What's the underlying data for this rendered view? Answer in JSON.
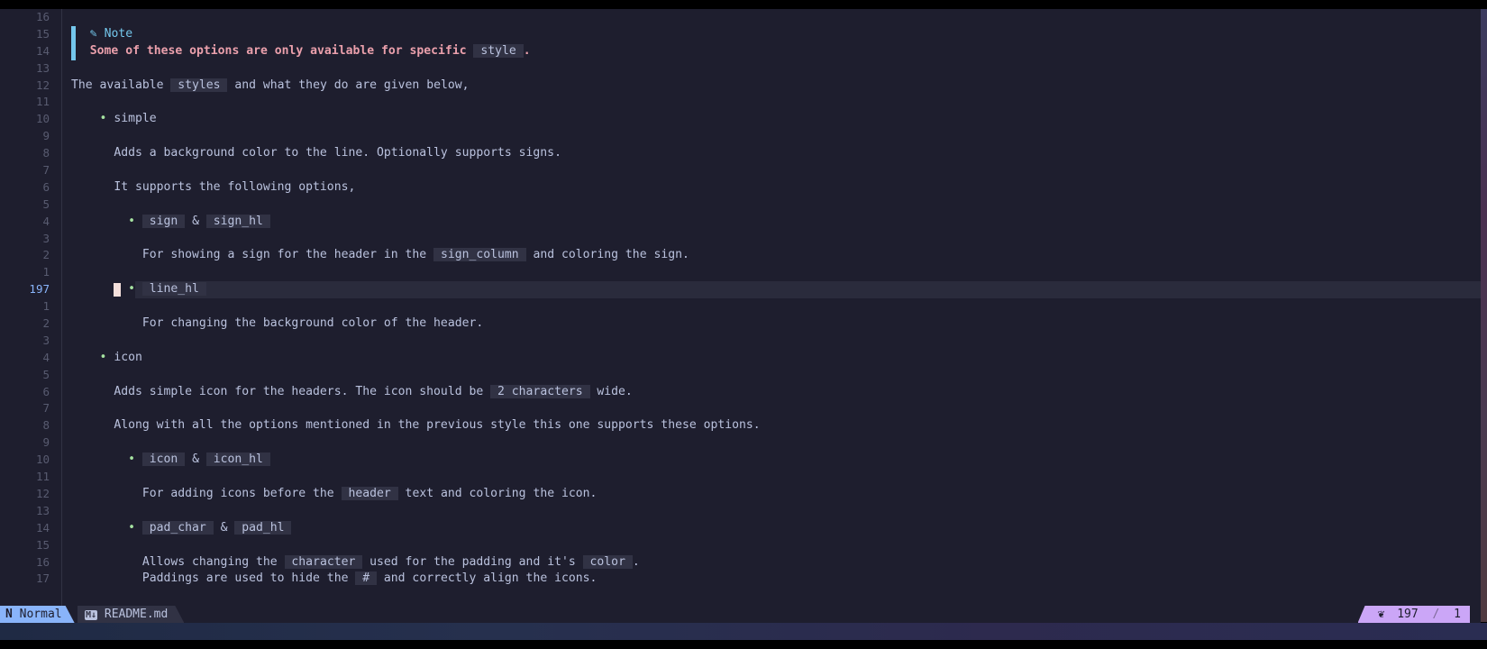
{
  "colors": {
    "background": "#1e1e2e",
    "code_bg": "#313244",
    "note": "#74c7ec",
    "note_text": "#eba0ac",
    "bullet": "#a6e3a1",
    "mode": "#89b4fa",
    "position": "#cba6f7",
    "cursor": "#f5e0dc"
  },
  "lines": [
    {
      "num": "16",
      "kind": "empty"
    },
    {
      "num": "15",
      "kind": "note-title",
      "icon": "pencil-icon",
      "segments": [
        {
          "t": "Note"
        }
      ]
    },
    {
      "num": "14",
      "kind": "note-text",
      "segments": [
        {
          "t": "Some of these options are only available for specific "
        },
        {
          "t": "style",
          "code": true
        },
        {
          "t": "."
        }
      ]
    },
    {
      "num": "13",
      "kind": "empty"
    },
    {
      "num": "12",
      "kind": "para",
      "level": 0,
      "segments": [
        {
          "t": "The available "
        },
        {
          "t": "styles",
          "code": true
        },
        {
          "t": " and what they do are given below,"
        }
      ]
    },
    {
      "num": "11",
      "kind": "empty"
    },
    {
      "num": "10",
      "kind": "bullet",
      "level": 1,
      "segments": [
        {
          "t": "simple"
        }
      ]
    },
    {
      "num": "9",
      "kind": "empty"
    },
    {
      "num": "8",
      "kind": "para",
      "level": 1,
      "segments": [
        {
          "t": "Adds a background color to the line. Optionally supports signs."
        }
      ]
    },
    {
      "num": "7",
      "kind": "empty"
    },
    {
      "num": "6",
      "kind": "para",
      "level": 1,
      "segments": [
        {
          "t": "It supports the following options,"
        }
      ]
    },
    {
      "num": "5",
      "kind": "empty"
    },
    {
      "num": "4",
      "kind": "bullet",
      "level": 2,
      "segments": [
        {
          "t": "sign",
          "code": true
        },
        {
          "t": " & "
        },
        {
          "t": "sign_hl",
          "code": true
        }
      ]
    },
    {
      "num": "3",
      "kind": "empty"
    },
    {
      "num": "2",
      "kind": "para",
      "level": 2,
      "segments": [
        {
          "t": "For showing a sign for the header in the "
        },
        {
          "t": "sign_column",
          "code": true
        },
        {
          "t": " and coloring the sign."
        }
      ]
    },
    {
      "num": "1",
      "kind": "empty"
    },
    {
      "num": "197",
      "kind": "bullet",
      "level": 2,
      "current": true,
      "segments": [
        {
          "t": "line_hl",
          "code": true
        }
      ]
    },
    {
      "num": "1",
      "kind": "empty"
    },
    {
      "num": "2",
      "kind": "para",
      "level": 2,
      "segments": [
        {
          "t": "For changing the background color of the header."
        }
      ]
    },
    {
      "num": "3",
      "kind": "empty"
    },
    {
      "num": "4",
      "kind": "bullet",
      "level": 1,
      "segments": [
        {
          "t": "icon"
        }
      ]
    },
    {
      "num": "5",
      "kind": "empty"
    },
    {
      "num": "6",
      "kind": "para",
      "level": 1,
      "segments": [
        {
          "t": "Adds simple icon for the headers. The icon should be "
        },
        {
          "t": "2 characters",
          "code": true
        },
        {
          "t": " wide."
        }
      ]
    },
    {
      "num": "7",
      "kind": "empty"
    },
    {
      "num": "8",
      "kind": "para",
      "level": 1,
      "segments": [
        {
          "t": "Along with all the options mentioned in the previous style this one supports these options."
        }
      ]
    },
    {
      "num": "9",
      "kind": "empty"
    },
    {
      "num": "10",
      "kind": "bullet",
      "level": 2,
      "segments": [
        {
          "t": "icon",
          "code": true
        },
        {
          "t": " & "
        },
        {
          "t": "icon_hl",
          "code": true
        }
      ]
    },
    {
      "num": "11",
      "kind": "empty"
    },
    {
      "num": "12",
      "kind": "para",
      "level": 2,
      "segments": [
        {
          "t": "For adding icons before the "
        },
        {
          "t": "header",
          "code": true
        },
        {
          "t": " text and coloring the icon."
        }
      ]
    },
    {
      "num": "13",
      "kind": "empty"
    },
    {
      "num": "14",
      "kind": "bullet",
      "level": 2,
      "segments": [
        {
          "t": "pad_char",
          "code": true
        },
        {
          "t": " & "
        },
        {
          "t": "pad_hl",
          "code": true
        }
      ]
    },
    {
      "num": "15",
      "kind": "empty"
    },
    {
      "num": "16",
      "kind": "para",
      "level": 2,
      "segments": [
        {
          "t": "Allows changing the "
        },
        {
          "t": "character",
          "code": true
        },
        {
          "t": " used for the padding and it's "
        },
        {
          "t": "color",
          "code": true
        },
        {
          "t": "."
        }
      ]
    },
    {
      "num": "17",
      "kind": "para",
      "level": 2,
      "segments": [
        {
          "t": "Paddings are used to hide the "
        },
        {
          "t": "#",
          "code": true
        },
        {
          "t": " and correctly align the icons."
        }
      ]
    }
  ],
  "statusline": {
    "mode": "Normal",
    "mode_icon": "neovim-icon",
    "file": "README.md",
    "file_icon": "markdown-icon",
    "position_icon": "leaf-icon",
    "line": "197",
    "column": "1"
  }
}
